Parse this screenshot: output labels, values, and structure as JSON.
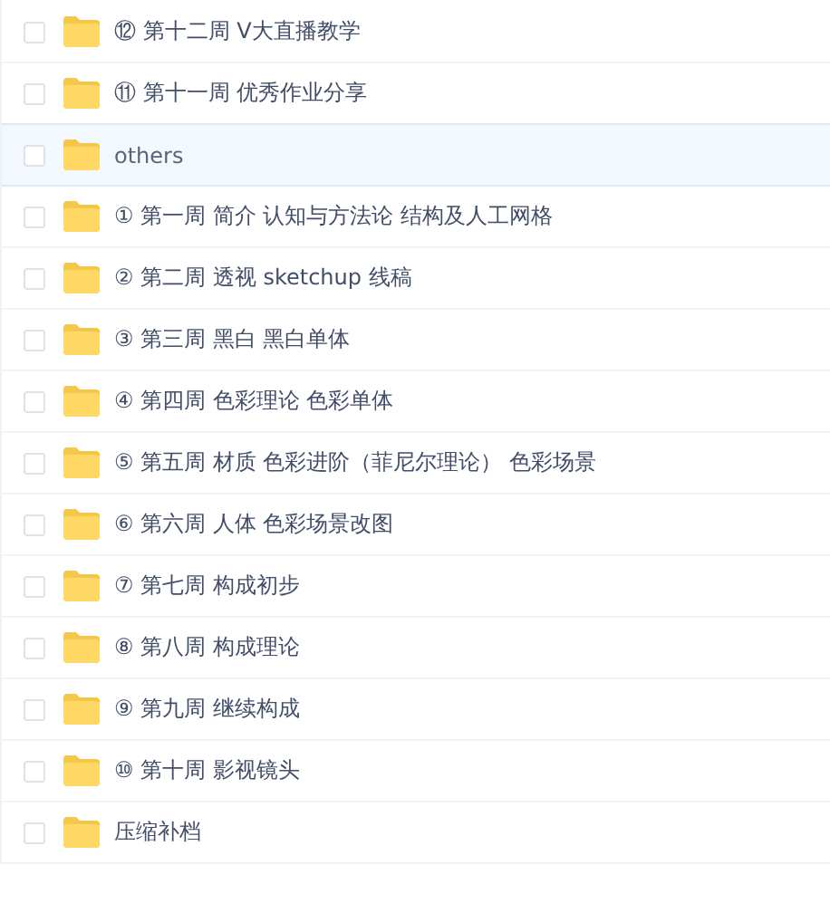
{
  "files": [
    {
      "name": "⑫ 第十二周 V大直播教学",
      "checked": false,
      "highlighted": false
    },
    {
      "name": "⑪ 第十一周 优秀作业分享",
      "checked": false,
      "highlighted": false
    },
    {
      "name": "others",
      "checked": false,
      "highlighted": true
    },
    {
      "name": "① 第一周 简介 认知与方法论 结构及人工网格",
      "checked": false,
      "highlighted": false
    },
    {
      "name": "② 第二周 透视 sketchup 线稿",
      "checked": false,
      "highlighted": false
    },
    {
      "name": "③ 第三周 黑白 黑白单体",
      "checked": false,
      "highlighted": false
    },
    {
      "name": "④ 第四周 色彩理论 色彩单体",
      "checked": false,
      "highlighted": false
    },
    {
      "name": "⑤ 第五周 材质 色彩进阶（菲尼尔理论） 色彩场景",
      "checked": false,
      "highlighted": false
    },
    {
      "name": "⑥ 第六周 人体 色彩场景改图",
      "checked": false,
      "highlighted": false
    },
    {
      "name": "⑦ 第七周 构成初步",
      "checked": false,
      "highlighted": false
    },
    {
      "name": "⑧ 第八周 构成理论",
      "checked": false,
      "highlighted": false
    },
    {
      "name": "⑨ 第九周 继续构成",
      "checked": false,
      "highlighted": false
    },
    {
      "name": "⑩ 第十周 影视镜头",
      "checked": false,
      "highlighted": false
    },
    {
      "name": "压缩补档",
      "checked": false,
      "highlighted": false
    }
  ]
}
